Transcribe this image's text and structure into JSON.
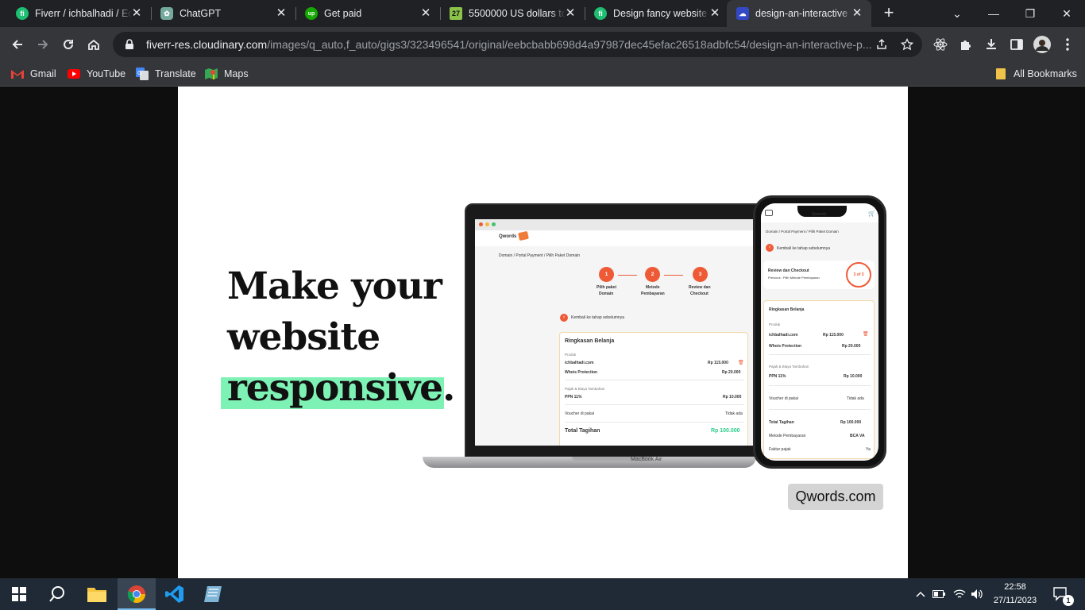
{
  "browser": {
    "tabs": [
      {
        "title": "Fiverr / ichbalhadi / Ed",
        "favicon": "fiverr-icon",
        "color": "#1dbf73"
      },
      {
        "title": "ChatGPT",
        "favicon": "chatgpt-icon",
        "color": "#74aa9c"
      },
      {
        "title": "Get paid",
        "favicon": "upwork-icon",
        "color": "#14a800"
      },
      {
        "title": "5500000 US dollars to",
        "favicon": "calculator-icon",
        "color": "#8bc34a"
      },
      {
        "title": "Design fancy website",
        "favicon": "fiverr-icon",
        "color": "#1dbf73"
      },
      {
        "title": "design-an-interactive",
        "favicon": "cloudinary-icon",
        "color": "#3448c5"
      }
    ],
    "active_tab_index": 5,
    "address": {
      "host": "fiverr-res.cloudinary.com",
      "path": "/images/q_auto,f_auto/gigs3/323496541/original/eebcbabb698d4a97987dec45efac26518adbfc54/design-an-interactive-p..."
    },
    "bookmarks": [
      {
        "label": "Gmail",
        "icon": "gmail-icon"
      },
      {
        "label": "YouTube",
        "icon": "youtube-icon"
      },
      {
        "label": "Translate",
        "icon": "translate-icon"
      },
      {
        "label": "Maps",
        "icon": "maps-icon"
      }
    ],
    "all_bookmarks_label": "All Bookmarks"
  },
  "page": {
    "headline": {
      "line1": "Make your",
      "line2": "website",
      "highlight": "responsive",
      "period": "."
    },
    "highlight_color": "#7ef1b5",
    "badge": "Qwords.com",
    "laptop": {
      "brand": "Qwords",
      "breadcrumb": "Domain / Portal Payment / Pilih Paket Domain",
      "steps": [
        {
          "num": "1",
          "label1": "Pilih paket",
          "label2": "Domain"
        },
        {
          "num": "2",
          "label1": "Metode",
          "label2": "Pembayaran"
        },
        {
          "num": "3",
          "label1": "Review dan",
          "label2": "Checkout"
        }
      ],
      "back": "Kembali ke tahap sebelumnya",
      "summary_title": "Ringkasan Belanja",
      "product_label": "Produk",
      "items": [
        {
          "name": "ichbalhadi.com",
          "price": "Rp 115.000"
        },
        {
          "name": "Whois Protection",
          "price": "Rp 20.000"
        }
      ],
      "tax_label": "Pajak & Biaya Tambahan",
      "tax_item": {
        "name": "PPN 11%",
        "price": "Rp 10.000"
      },
      "voucher": {
        "name": "Voucher di pakai",
        "value": "Tidak ada"
      },
      "total": {
        "name": "Total Tagihan",
        "value": "Rp 100.000"
      },
      "model": "MacBook Air"
    },
    "phone": {
      "brand": "Qwords",
      "breadcrumb": "Domain / Portal Payment / Pilih Paket Domain",
      "back": "Kembali ke tahap sebelumnya",
      "review_title": "Review dan Checkout",
      "review_sub": "Previous : Pilih Metode Pembayaran",
      "progress": "3 of 3",
      "summary_title": "Ringkasan Belanja",
      "product_label": "Produk",
      "items": [
        {
          "name": "ichbalhadi.com",
          "price": "Rp 115.000"
        },
        {
          "name": "Whois Protection",
          "price": "Rp 20.000"
        }
      ],
      "tax_label": "Pajak & Biaya Tambahan",
      "tax_item": {
        "name": "PPN 11%",
        "price": "Rp 10.000"
      },
      "voucher": {
        "name": "Voucher di pakai",
        "value": "Tidak ada"
      },
      "total": {
        "name": "Total Tagihan",
        "value": "Rp 100.000"
      },
      "method": {
        "name": "Metode Pembayaran",
        "value": "BCA VA"
      },
      "invoice": {
        "name": "Faktur pajak",
        "value": "Ya"
      }
    }
  },
  "taskbar": {
    "time": "22:58",
    "date": "27/11/2023",
    "notification_count": "1"
  }
}
